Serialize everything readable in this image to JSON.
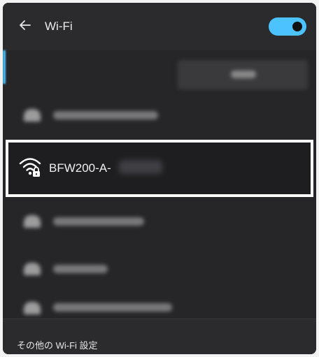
{
  "header": {
    "title": "Wi-Fi",
    "back_icon": "back-arrow-icon",
    "toggle_on": true,
    "accent": "#4cc2ff"
  },
  "selected_network": {
    "ssid": "BFW200-A-",
    "icon": "wifi-secured-icon"
  },
  "footer": {
    "more_settings": "その他の Wi-Fi 設定"
  }
}
